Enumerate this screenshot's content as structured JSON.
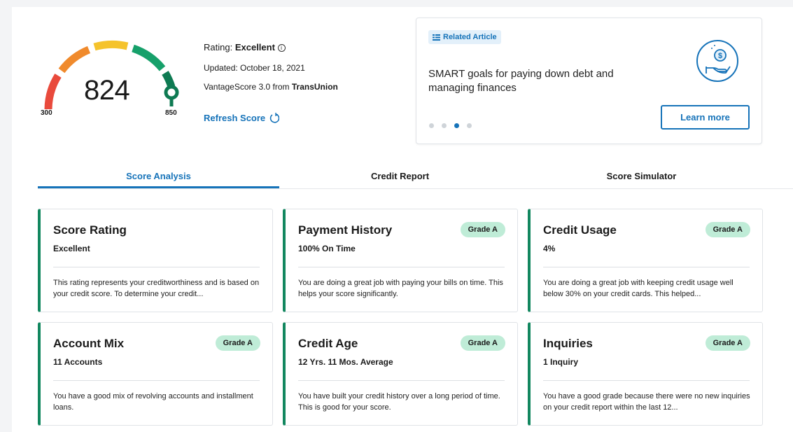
{
  "score": {
    "value": "824",
    "min_label": "300",
    "max_label": "850",
    "rating_label": "Rating:",
    "rating_value": "Excellent",
    "updated": "Updated: October 18, 2021",
    "source_prefix": "VantageScore 3.0 from ",
    "source_brand": "TransUnion",
    "refresh_label": "Refresh Score"
  },
  "article": {
    "badge": "Related Article",
    "title": "SMART goals for paying down debt and managing finances",
    "button": "Learn more",
    "dots_total": 4,
    "dots_active_index": 2
  },
  "tabs": [
    {
      "label": "Score Analysis",
      "active": true
    },
    {
      "label": "Credit Report",
      "active": false
    },
    {
      "label": "Score Simulator",
      "active": false
    }
  ],
  "cards": [
    {
      "title": "Score Rating",
      "grade": "",
      "value": "Excellent",
      "description": "This rating represents your creditworthiness and is based on your credit score. To determine your credit..."
    },
    {
      "title": "Payment History",
      "grade": "Grade A",
      "value": "100% On Time",
      "description": "You are doing a great job with paying your bills on time. This helps your score significantly."
    },
    {
      "title": "Credit Usage",
      "grade": "Grade A",
      "value": "4%",
      "description": "You are doing a great job with keeping credit usage well below 30% on your credit cards. This helped..."
    },
    {
      "title": "Account Mix",
      "grade": "Grade A",
      "value": "11 Accounts",
      "description": "You have a good mix of revolving accounts and installment loans."
    },
    {
      "title": "Credit Age",
      "grade": "Grade A",
      "value": "12 Yrs. 11 Mos. Average",
      "description": "You have built your credit history over a long period of time. This is good for your score."
    },
    {
      "title": "Inquiries",
      "grade": "Grade A",
      "value": "1 Inquiry",
      "description": "You have a good grade because there were no new inquiries on your credit report within the last 12..."
    }
  ],
  "colors": {
    "accent": "#1673b9",
    "good_green": "#12875f",
    "grade_bg": "#bfecd7",
    "gauge_red": "#e94a3c",
    "gauge_orange": "#f08a2c",
    "gauge_yellow": "#f5c32c",
    "gauge_green": "#16a06a"
  }
}
